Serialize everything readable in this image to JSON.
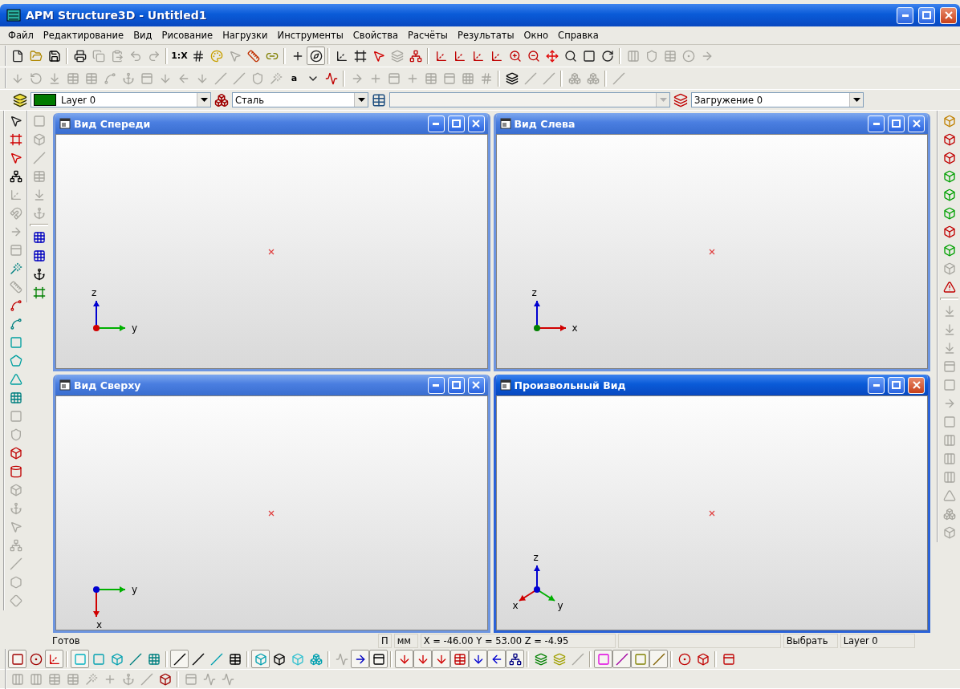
{
  "window": {
    "title": "APM Structure3D - Untitled1"
  },
  "menu": [
    "Файл",
    "Редактирование",
    "Вид",
    "Рисование",
    "Нагрузки",
    "Инструменты",
    "Свойства",
    "Расчёты",
    "Результаты",
    "Окно",
    "Справка"
  ],
  "toolbar_1": [
    {
      "disabled": false,
      "pressed": false
    },
    {
      "disabled": false,
      "pressed": false
    },
    {
      "disabled": false,
      "pressed": false
    },
    {
      "disabled": false,
      "pressed": false
    },
    {
      "disabled": true,
      "pressed": false
    },
    {
      "disabled": true,
      "pressed": false
    },
    {
      "disabled": true,
      "pressed": false
    },
    {
      "disabled": true,
      "pressed": false
    },
    {
      "label": "1:X",
      "disabled": false,
      "pressed": false
    },
    {
      "disabled": false,
      "pressed": false
    },
    {
      "disabled": false,
      "pressed": false
    },
    {
      "disabled": true,
      "pressed": false
    },
    {
      "disabled": false,
      "pressed": false
    },
    {
      "disabled": false,
      "pressed": false
    },
    {
      "disabled": false,
      "pressed": false
    },
    {
      "disabled": false,
      "pressed": true
    },
    {
      "disabled": false,
      "pressed": false
    },
    {
      "disabled": false,
      "pressed": false
    },
    {
      "disabled": false,
      "pressed": false
    },
    {
      "disabled": true,
      "pressed": false
    },
    {
      "disabled": false,
      "pressed": false
    },
    {
      "disabled": false,
      "pressed": false
    },
    {
      "disabled": false,
      "pressed": false
    },
    {
      "disabled": false,
      "pressed": false
    },
    {
      "disabled": false,
      "pressed": false
    },
    {
      "disabled": false,
      "pressed": false
    },
    {
      "disabled": false,
      "pressed": false
    },
    {
      "disabled": false,
      "pressed": false
    },
    {
      "disabled": false,
      "pressed": false
    },
    {
      "disabled": false,
      "pressed": false
    },
    {
      "disabled": false,
      "pressed": false
    },
    {
      "disabled": true,
      "pressed": false
    },
    {
      "disabled": true,
      "pressed": false
    },
    {
      "disabled": true,
      "pressed": false
    },
    {
      "disabled": true,
      "pressed": false
    },
    {
      "disabled": true,
      "pressed": false
    }
  ],
  "toolbar_2": [
    {
      "disabled": true,
      "pressed": false
    },
    {
      "disabled": true,
      "pressed": false
    },
    {
      "disabled": true,
      "pressed": false
    },
    {
      "disabled": true,
      "pressed": false
    },
    {
      "disabled": true,
      "pressed": false
    },
    {
      "disabled": true,
      "pressed": false
    },
    {
      "disabled": true,
      "pressed": false
    },
    {
      "disabled": true,
      "pressed": false
    },
    {
      "disabled": true,
      "pressed": false
    },
    {
      "disabled": true,
      "pressed": false
    },
    {
      "disabled": true,
      "pressed": false
    },
    {
      "disabled": true,
      "pressed": false
    },
    {
      "disabled": true,
      "pressed": false
    },
    {
      "disabled": true,
      "pressed": false
    },
    {
      "disabled": true,
      "pressed": false
    },
    {
      "label": "a",
      "disabled": false,
      "pressed": false
    },
    {
      "disabled": false,
      "pressed": false
    },
    {
      "disabled": false,
      "pressed": false
    },
    {
      "disabled": true,
      "pressed": false
    },
    {
      "disabled": true,
      "pressed": false
    },
    {
      "disabled": true,
      "pressed": false
    },
    {
      "disabled": true,
      "pressed": false
    },
    {
      "disabled": true,
      "pressed": false
    },
    {
      "disabled": true,
      "pressed": false
    },
    {
      "disabled": true,
      "pressed": false
    },
    {
      "disabled": true,
      "pressed": false
    },
    {
      "disabled": false,
      "pressed": false
    },
    {
      "disabled": true,
      "pressed": false
    },
    {
      "disabled": true,
      "pressed": false
    },
    {
      "disabled": true,
      "pressed": false
    },
    {
      "disabled": true,
      "pressed": false
    },
    {
      "disabled": true,
      "pressed": false
    }
  ],
  "properties_bar": {
    "layer": {
      "value": "Layer 0",
      "color": "#007a00"
    },
    "material": {
      "value": "Сталь"
    },
    "section": {
      "disabled": true
    },
    "load_case": {
      "value": "Загружение 0"
    }
  },
  "left_toolbar_1": [
    {
      "disabled": false,
      "pressed": false
    },
    {
      "disabled": false,
      "pressed": false
    },
    {
      "disabled": false,
      "pressed": false
    },
    {
      "disabled": false,
      "pressed": false
    },
    {
      "disabled": true,
      "pressed": false
    },
    {
      "disabled": true,
      "pressed": false
    },
    {
      "disabled": true,
      "pressed": false
    },
    {
      "disabled": true,
      "pressed": false
    },
    {
      "disabled": false,
      "pressed": false
    },
    {
      "disabled": true,
      "pressed": false
    },
    {
      "disabled": false,
      "pressed": false
    },
    {
      "disabled": false,
      "pressed": false
    },
    {
      "disabled": false,
      "pressed": false
    },
    {
      "disabled": false,
      "pressed": false
    },
    {
      "disabled": false,
      "pressed": false
    },
    {
      "disabled": false,
      "pressed": false
    },
    {
      "disabled": true,
      "pressed": false
    },
    {
      "disabled": true,
      "pressed": false
    },
    {
      "disabled": false,
      "pressed": false
    },
    {
      "disabled": false,
      "pressed": false
    },
    {
      "disabled": true,
      "pressed": false
    },
    {
      "disabled": true,
      "pressed": false
    },
    {
      "disabled": true,
      "pressed": false
    },
    {
      "disabled": true,
      "pressed": false
    },
    {
      "disabled": true,
      "pressed": false
    },
    {
      "disabled": true,
      "pressed": false
    },
    {
      "disabled": true,
      "pressed": false
    }
  ],
  "left_toolbar_2": [
    {
      "disabled": true,
      "pressed": false
    },
    {
      "disabled": true,
      "pressed": false
    },
    {
      "disabled": true,
      "pressed": false
    },
    {
      "disabled": true,
      "pressed": false
    },
    {
      "disabled": true,
      "pressed": false
    },
    {
      "disabled": true,
      "pressed": false
    },
    {
      "disabled": false,
      "pressed": false
    },
    {
      "disabled": false,
      "pressed": false
    },
    {
      "disabled": false,
      "pressed": false
    },
    {
      "disabled": false,
      "pressed": false
    }
  ],
  "right_toolbar": [
    {
      "disabled": false,
      "pressed": false
    },
    {
      "disabled": false,
      "pressed": false
    },
    {
      "disabled": false,
      "pressed": false
    },
    {
      "disabled": false,
      "pressed": false
    },
    {
      "disabled": false,
      "pressed": false
    },
    {
      "disabled": false,
      "pressed": false
    },
    {
      "disabled": false,
      "pressed": false
    },
    {
      "disabled": false,
      "pressed": false
    },
    {
      "disabled": true,
      "pressed": false
    },
    {
      "disabled": false,
      "pressed": false
    },
    {
      "disabled": true,
      "pressed": false
    },
    {
      "disabled": true,
      "pressed": false
    },
    {
      "disabled": true,
      "pressed": false
    },
    {
      "disabled": true,
      "pressed": false
    },
    {
      "disabled": true,
      "pressed": false
    },
    {
      "disabled": true,
      "pressed": false
    },
    {
      "disabled": true,
      "pressed": false
    },
    {
      "disabled": true,
      "pressed": false
    },
    {
      "disabled": true,
      "pressed": false
    },
    {
      "disabled": true,
      "pressed": false
    },
    {
      "disabled": true,
      "pressed": false
    },
    {
      "disabled": true,
      "pressed": false
    },
    {
      "disabled": true,
      "pressed": false
    }
  ],
  "views": [
    {
      "title": "Вид Спереди",
      "kind": "front",
      "active": false,
      "axes": [
        "z",
        "y"
      ]
    },
    {
      "title": "Вид Слева",
      "kind": "left",
      "active": false,
      "axes": [
        "z",
        "x"
      ]
    },
    {
      "title": "Вид Сверху",
      "kind": "top",
      "active": false,
      "axes": [
        "y",
        "x"
      ]
    },
    {
      "title": "Произвольный Вид",
      "kind": "iso",
      "active": true,
      "axes": [
        "z",
        "x",
        "y"
      ]
    }
  ],
  "status_bar": {
    "message": "Готов",
    "mode": "П",
    "units": "мм",
    "coordinates": "X = -46.00 Y = 53.00 Z = -4.95",
    "action": "Выбрать",
    "layer": "Layer 0"
  },
  "bottom_toolbar_1": [
    {
      "disabled": false,
      "pressed": true
    },
    {
      "disabled": false,
      "pressed": false
    },
    {
      "disabled": false,
      "pressed": true
    },
    {
      "disabled": false,
      "pressed": true
    },
    {
      "disabled": false,
      "pressed": false
    },
    {
      "disabled": false,
      "pressed": false
    },
    {
      "disabled": false,
      "pressed": false
    },
    {
      "disabled": false,
      "pressed": false
    },
    {
      "disabled": false,
      "pressed": true
    },
    {
      "disabled": false,
      "pressed": false
    },
    {
      "disabled": false,
      "pressed": false
    },
    {
      "disabled": false,
      "pressed": false
    },
    {
      "disabled": false,
      "pressed": true
    },
    {
      "disabled": false,
      "pressed": false
    },
    {
      "disabled": false,
      "pressed": false
    },
    {
      "disabled": false,
      "pressed": false
    },
    {
      "disabled": true,
      "pressed": false
    },
    {
      "disabled": false,
      "pressed": true
    },
    {
      "disabled": false,
      "pressed": true
    },
    {
      "disabled": false,
      "pressed": true
    },
    {
      "disabled": false,
      "pressed": true
    },
    {
      "disabled": false,
      "pressed": true
    },
    {
      "disabled": false,
      "pressed": true
    },
    {
      "disabled": false,
      "pressed": true
    },
    {
      "disabled": false,
      "pressed": true
    },
    {
      "disabled": false,
      "pressed": true
    },
    {
      "disabled": false,
      "pressed": false
    },
    {
      "disabled": false,
      "pressed": false
    },
    {
      "disabled": true,
      "pressed": false
    },
    {
      "disabled": false,
      "pressed": true
    },
    {
      "disabled": false,
      "pressed": true
    },
    {
      "disabled": false,
      "pressed": true
    },
    {
      "disabled": false,
      "pressed": true
    },
    {
      "disabled": false,
      "pressed": false
    },
    {
      "disabled": false,
      "pressed": false
    },
    {
      "disabled": false,
      "pressed": false
    }
  ],
  "bottom_toolbar_2": [
    {
      "disabled": true,
      "pressed": false
    },
    {
      "disabled": true,
      "pressed": false
    },
    {
      "disabled": true,
      "pressed": false
    },
    {
      "disabled": true,
      "pressed": false
    },
    {
      "disabled": true,
      "pressed": false
    },
    {
      "disabled": true,
      "pressed": false
    },
    {
      "disabled": true,
      "pressed": false
    },
    {
      "disabled": true,
      "pressed": false
    },
    {
      "disabled": false,
      "pressed": false
    },
    {
      "disabled": true,
      "pressed": false
    },
    {
      "disabled": true,
      "pressed": false
    },
    {
      "disabled": true,
      "pressed": false
    }
  ]
}
